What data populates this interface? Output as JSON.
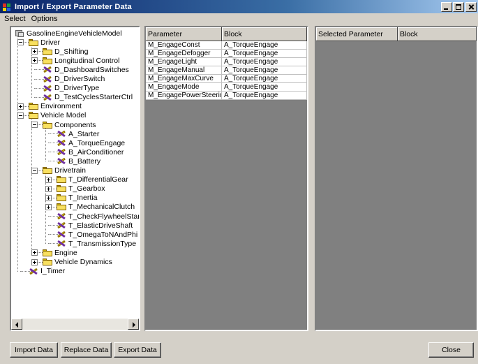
{
  "window": {
    "title": "Import / Export Parameter Data",
    "minimize": "minimize",
    "maximize": "maximize",
    "close": "close"
  },
  "menu": [
    "Select",
    "Options"
  ],
  "tree": {
    "nodes": [
      {
        "label": "GasolineEngineVehicleModel",
        "icon": "root-icon",
        "level": 0,
        "expander": "none"
      },
      {
        "label": "Driver",
        "icon": "folder-icon",
        "level": 1,
        "expander": "minus"
      },
      {
        "label": "D_Shifting",
        "icon": "folder-icon",
        "level": 2,
        "expander": "plus"
      },
      {
        "label": "Longitudinal Control",
        "icon": "folder-icon",
        "level": 2,
        "expander": "plus"
      },
      {
        "label": "D_DashboardSwitches",
        "icon": "parameter-icon",
        "level": 2,
        "expander": "none"
      },
      {
        "label": "D_DriverSwitch",
        "icon": "parameter-icon",
        "level": 2,
        "expander": "none"
      },
      {
        "label": "D_DriverType",
        "icon": "parameter-icon",
        "level": 2,
        "expander": "none"
      },
      {
        "label": "D_TestCyclesStarterCtrl",
        "icon": "parameter-icon",
        "level": 2,
        "expander": "none"
      },
      {
        "label": "Environment",
        "icon": "folder-icon",
        "level": 1,
        "expander": "plus"
      },
      {
        "label": "Vehicle Model",
        "icon": "folder-icon",
        "level": 1,
        "expander": "minus"
      },
      {
        "label": "Components",
        "icon": "folder-icon",
        "level": 2,
        "expander": "minus"
      },
      {
        "label": "A_Starter",
        "icon": "parameter-icon",
        "level": 3,
        "expander": "none"
      },
      {
        "label": "A_TorqueEngage",
        "icon": "parameter-icon",
        "level": 3,
        "expander": "none"
      },
      {
        "label": "B_AirConditioner",
        "icon": "parameter-icon",
        "level": 3,
        "expander": "none"
      },
      {
        "label": "B_Battery",
        "icon": "parameter-icon",
        "level": 3,
        "expander": "none"
      },
      {
        "label": "Drivetrain",
        "icon": "folder-icon",
        "level": 2,
        "expander": "minus"
      },
      {
        "label": "T_DifferentialGear",
        "icon": "folder-icon",
        "level": 3,
        "expander": "plus"
      },
      {
        "label": "T_Gearbox",
        "icon": "folder-icon",
        "level": 3,
        "expander": "plus"
      },
      {
        "label": "T_Inertia",
        "icon": "folder-icon",
        "level": 3,
        "expander": "plus"
      },
      {
        "label": "T_MechanicalClutch",
        "icon": "folder-icon",
        "level": 3,
        "expander": "plus"
      },
      {
        "label": "T_CheckFlywheelStandstill",
        "icon": "parameter-icon",
        "level": 3,
        "expander": "none"
      },
      {
        "label": "T_ElasticDriveShaft",
        "icon": "parameter-icon",
        "level": 3,
        "expander": "none"
      },
      {
        "label": "T_OmegaToNAndPhi",
        "icon": "parameter-icon",
        "level": 3,
        "expander": "none"
      },
      {
        "label": "T_TransmissionType",
        "icon": "parameter-icon",
        "level": 3,
        "expander": "none"
      },
      {
        "label": "Engine",
        "icon": "folder-icon",
        "level": 2,
        "expander": "plus"
      },
      {
        "label": "Vehicle Dynamics",
        "icon": "folder-icon",
        "level": 2,
        "expander": "plus"
      },
      {
        "label": "I_Timer",
        "icon": "parameter-icon",
        "level": 1,
        "expander": "none"
      }
    ]
  },
  "param_grid": {
    "headers": [
      "Parameter",
      "Block"
    ],
    "rows": [
      [
        "M_EngageConst",
        "A_TorqueEngage"
      ],
      [
        "M_EngageDefogger",
        "A_TorqueEngage"
      ],
      [
        "M_EngageLight",
        "A_TorqueEngage"
      ],
      [
        "M_EngageManual",
        "A_TorqueEngage"
      ],
      [
        "M_EngageMaxCurve",
        "A_TorqueEngage"
      ],
      [
        "M_EngageMode",
        "A_TorqueEngage"
      ],
      [
        "M_EngagePowerSteering",
        "A_TorqueEngage"
      ]
    ]
  },
  "selected_grid": {
    "headers": [
      "Selected Parameter",
      "Block"
    ]
  },
  "buttons": {
    "import": "Import Data",
    "replace": "Replace Data",
    "export": "Export Data",
    "close": "Close"
  }
}
